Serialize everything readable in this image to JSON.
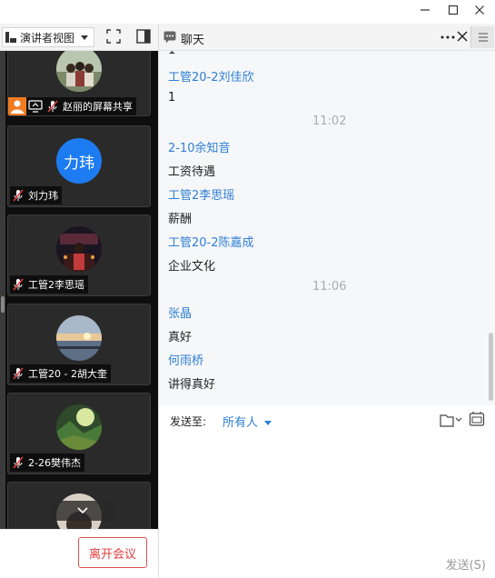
{
  "toolbar": {
    "view_label": "演讲者视图"
  },
  "chat_header": {
    "title": "聊天"
  },
  "participants": [
    {
      "name": "赵丽的屏幕共享",
      "avatar": "photo-group"
    },
    {
      "name": "刘力玮",
      "avatar_text": "力玮",
      "avatar_color": "#1e7cf2"
    },
    {
      "name": "工管2李思瑶",
      "avatar": "photo-night"
    },
    {
      "name": "工管20 - 2胡大奎",
      "avatar": "photo-sunset"
    },
    {
      "name": "2-26樊伟杰",
      "avatar": "photo-forest"
    },
    {
      "name": "",
      "avatar": "photo-partial"
    }
  ],
  "chat": {
    "messages": [
      {
        "type": "msg",
        "text": "1"
      },
      {
        "type": "sender",
        "text": "工管20-2刘佳欣"
      },
      {
        "type": "msg",
        "text": "1"
      },
      {
        "type": "time",
        "text": "11:02"
      },
      {
        "type": "sender",
        "text": "2-10余知音"
      },
      {
        "type": "msg",
        "text": "工资待遇"
      },
      {
        "type": "sender",
        "text": "工管2李思瑶"
      },
      {
        "type": "msg",
        "text": "薪酬"
      },
      {
        "type": "sender",
        "text": "工管20-2陈嘉成"
      },
      {
        "type": "msg",
        "text": "企业文化"
      },
      {
        "type": "time",
        "text": "11:06"
      },
      {
        "type": "sender",
        "text": "张晶"
      },
      {
        "type": "msg",
        "text": "真好"
      },
      {
        "type": "sender",
        "text": "何雨桥"
      },
      {
        "type": "msg",
        "text": "讲得真好"
      }
    ]
  },
  "input": {
    "send_to_label": "发送至:",
    "send_to_value": "所有人",
    "send_button": "发送(S)"
  },
  "bottom": {
    "leave_button": "离开会议"
  },
  "colors": {
    "accent": "#2e7fd6",
    "leave": "#e03b3b"
  }
}
